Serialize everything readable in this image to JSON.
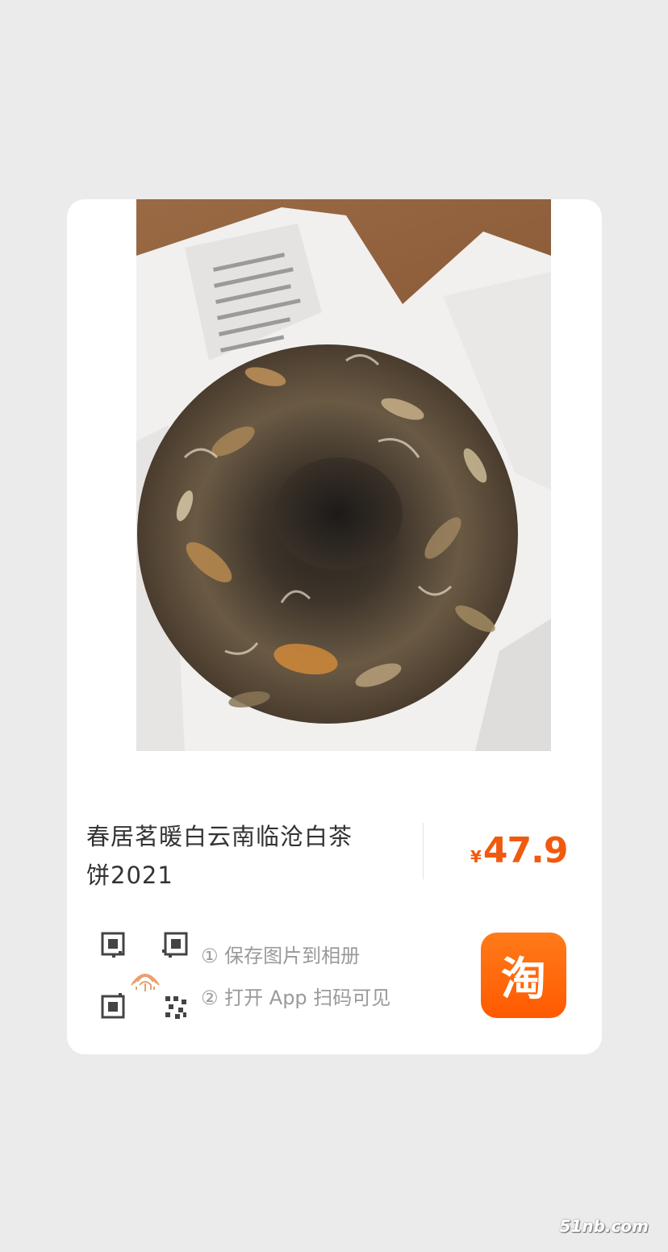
{
  "product": {
    "title_line1": "春居茗暖白云南临沧白茶",
    "title_line2": "饼2021",
    "currency_symbol": "¥",
    "price": "47.9"
  },
  "steps": {
    "step1": "① 保存图片到相册",
    "step2": "② 打开 App 扫码可见"
  },
  "app_badge": {
    "glyph": "淘",
    "icon": "taobao-app-icon"
  },
  "watermark": "51nb.com",
  "colors": {
    "background": "#ebebeb",
    "card": "#ffffff",
    "price": "#f05a0f",
    "badge": "#ff5a00"
  }
}
